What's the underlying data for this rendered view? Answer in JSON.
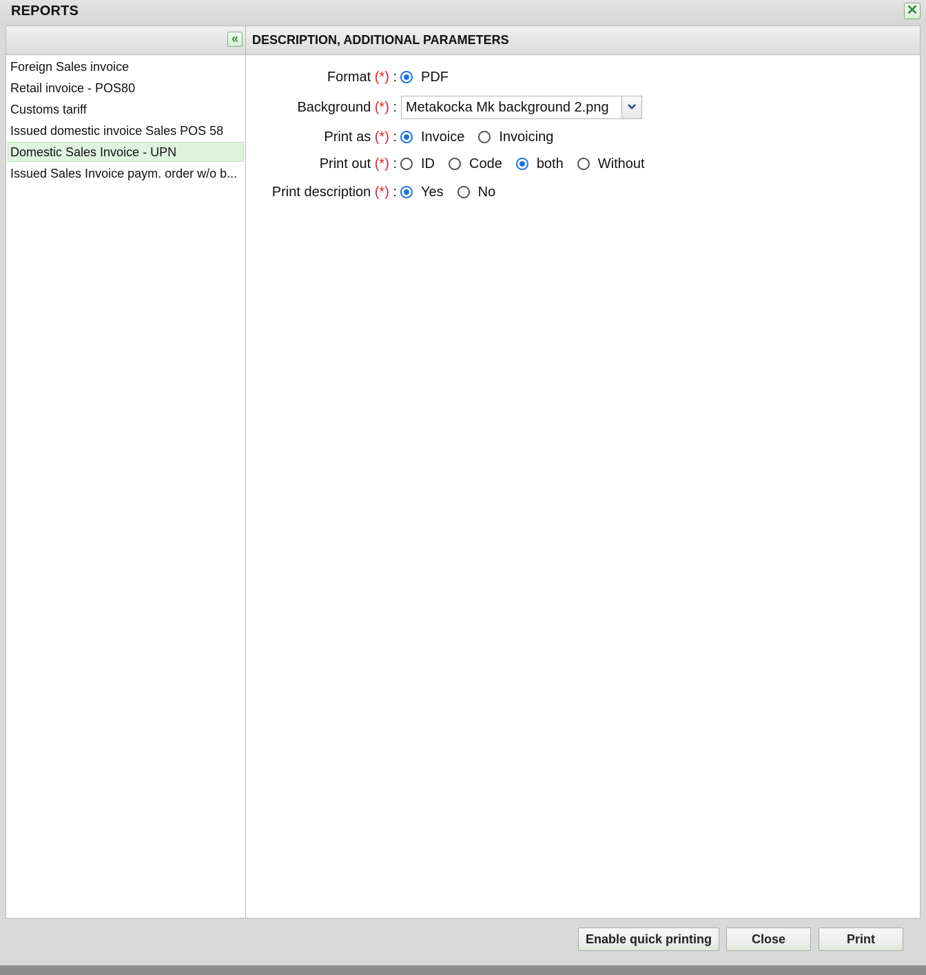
{
  "window": {
    "title": "REPORTS",
    "close_symbol": "✕"
  },
  "sidebar": {
    "collapse_symbol": "«",
    "items": [
      {
        "label": "Foreign Sales invoice"
      },
      {
        "label": "Retail invoice - POS80"
      },
      {
        "label": "Customs tariff"
      },
      {
        "label": "Issued domestic invoice Sales POS 58"
      },
      {
        "label": "Domestic Sales Invoice - UPN"
      },
      {
        "label": "Issued Sales Invoice paym. order w/o b..."
      }
    ],
    "selected_index": 4
  },
  "main": {
    "header": "DESCRIPTION, ADDITIONAL PARAMETERS",
    "required_marker": "(*)",
    "colon": ":",
    "fields": {
      "format": {
        "label": "Format",
        "options": [
          "PDF"
        ],
        "selected": "PDF"
      },
      "background": {
        "label": "Background",
        "value": "Metakocka Mk background 2.png"
      },
      "print_as": {
        "label": "Print as",
        "options": [
          "Invoice",
          "Invoicing"
        ],
        "selected": "Invoice"
      },
      "print_out": {
        "label": "Print out",
        "options": [
          "ID",
          "Code",
          "both",
          "Without"
        ],
        "selected": "both"
      },
      "print_description": {
        "label": "Print description",
        "options": [
          "Yes",
          "No"
        ],
        "selected": "Yes"
      }
    }
  },
  "footer": {
    "enable_quick_printing": "Enable quick printing",
    "close": "Close",
    "print": "Print"
  },
  "colors": {
    "accent": "#1a73e8",
    "required": "#e02020",
    "selected_row": "#dff3df"
  }
}
